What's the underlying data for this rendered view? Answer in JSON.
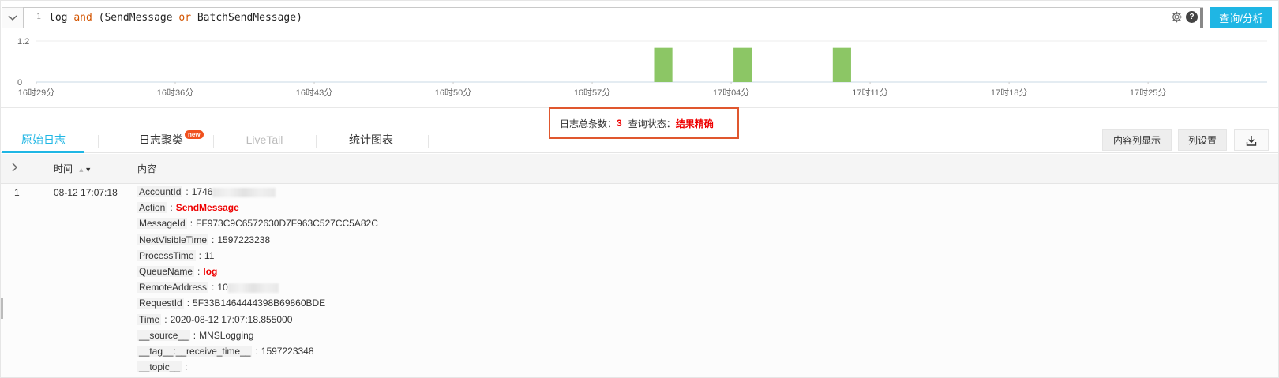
{
  "query": {
    "line_number": "1",
    "tokens": [
      {
        "text": "log ",
        "type": "text"
      },
      {
        "text": "and",
        "type": "keyword"
      },
      {
        "text": " (SendMessage ",
        "type": "text"
      },
      {
        "text": "or",
        "type": "keyword"
      },
      {
        "text": " BatchSendMessage)",
        "type": "text"
      }
    ],
    "search_label": "查询/分析",
    "icons": [
      "chevron-down-icon",
      "gear-icon",
      "help-icon"
    ]
  },
  "histogram": {
    "y_ticks": [
      "1.2",
      "0"
    ],
    "x_ticks": [
      "16时29分",
      "16时36分",
      "16时43分",
      "16时50分",
      "16时57分",
      "17时04分",
      "17时11分",
      "17时18分",
      "17时25分"
    ],
    "bar_color": "#8cc665"
  },
  "chart_data": {
    "type": "bar",
    "x_unit": "minutes",
    "x_range": [
      "16时29分",
      "17时31分"
    ],
    "categories": [
      "17时00分",
      "17时04分",
      "17时09分"
    ],
    "values": [
      1,
      1,
      1
    ],
    "ylim": [
      0,
      1.2
    ],
    "title": "",
    "xlabel": "",
    "ylabel": ""
  },
  "summary": {
    "count_label": "日志总条数：",
    "count_value": "3",
    "status_label": "查询状态：",
    "status_value": "结果精确"
  },
  "tabs": {
    "raw": "原始日志",
    "cluster": "日志聚类",
    "new_badge": "new",
    "livetail": "LiveTail",
    "charts": "统计图表"
  },
  "toolbar": {
    "content_display": "内容列显示",
    "column_settings": "列设置"
  },
  "table": {
    "headers": {
      "time": "时间",
      "content": "内容"
    },
    "rows": [
      {
        "index": "1",
        "time": "08-12 17:07:18",
        "fields": [
          {
            "key": "AccountId",
            "value": "1746",
            "redacted": true,
            "highlight": false
          },
          {
            "key": "Action",
            "value": "SendMessage",
            "redacted": false,
            "highlight": true
          },
          {
            "key": "MessageId",
            "value": "FF973C9C6572630D7F963C527CC5A82C",
            "redacted": false,
            "highlight": false
          },
          {
            "key": "NextVisibleTime",
            "value": "1597223238",
            "redacted": false,
            "highlight": false
          },
          {
            "key": "ProcessTime",
            "value": "11",
            "redacted": false,
            "highlight": false
          },
          {
            "key": "QueueName",
            "value": "log",
            "redacted": false,
            "highlight": true
          },
          {
            "key": "RemoteAddress",
            "value": "10",
            "redacted": true,
            "highlight": false
          },
          {
            "key": "RequestId",
            "value": "5F33B1464444398B69860BDE",
            "redacted": false,
            "highlight": false
          },
          {
            "key": "Time",
            "value": "2020-08-12 17:07:18.855000",
            "redacted": false,
            "highlight": false
          },
          {
            "key": "__source__",
            "value": "MNSLogging",
            "redacted": false,
            "highlight": false
          },
          {
            "key": "__tag__:__receive_time__",
            "value": "1597223348",
            "redacted": false,
            "highlight": false
          },
          {
            "key": "__topic__",
            "value": "",
            "redacted": false,
            "highlight": false
          }
        ]
      }
    ]
  }
}
